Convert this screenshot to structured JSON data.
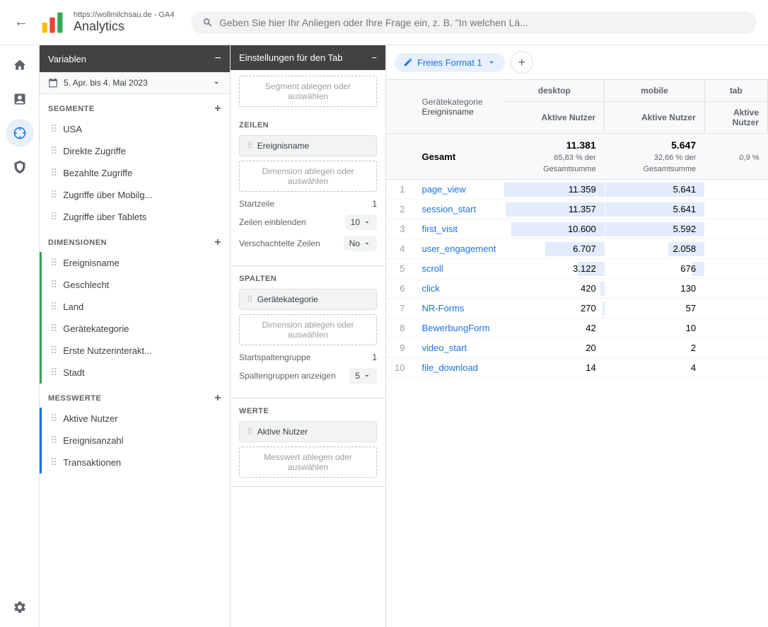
{
  "topbar": {
    "back_label": "←",
    "app_name": "Analytics",
    "subtitle": "https://wollmilchsau.de - GA4",
    "title": "https://wollmilchsau.de - GA4",
    "search_placeholder": "Geben Sie hier Ihr Anliegen oder Ihre Frage ein, z. B. \"In welchen Lä..."
  },
  "left_nav": {
    "icons": [
      {
        "name": "home-icon",
        "symbol": "⌂"
      },
      {
        "name": "chart-icon",
        "symbol": "▦"
      },
      {
        "name": "explore-icon",
        "symbol": "◎",
        "active": true
      },
      {
        "name": "ads-icon",
        "symbol": "◈"
      }
    ],
    "bottom_icons": [
      {
        "name": "settings-icon",
        "symbol": "⚙"
      }
    ]
  },
  "variables_panel": {
    "header": "Variablen",
    "date_label": "5. Apr. bis 4. Mai 2023",
    "sections": {
      "segments": {
        "title": "SEGMENTE",
        "items": [
          {
            "label": "USA"
          },
          {
            "label": "Direkte Zugriffe"
          },
          {
            "label": "Bezahlte Zugriffe"
          },
          {
            "label": "Zugriffe über Mobilg..."
          },
          {
            "label": "Zugriffe über Tablets"
          }
        ]
      },
      "dimensions": {
        "title": "DIMENSIONEN",
        "items": [
          {
            "label": "Ereignisname"
          },
          {
            "label": "Geschlecht"
          },
          {
            "label": "Land"
          },
          {
            "label": "Gerätekategorie"
          },
          {
            "label": "Erste Nutzerinterakt..."
          },
          {
            "label": "Stadt"
          }
        ]
      },
      "metrics": {
        "title": "MESSWERTE",
        "items": [
          {
            "label": "Aktive Nutzer"
          },
          {
            "label": "Ereignisanzahl"
          },
          {
            "label": "Transaktionen"
          }
        ]
      }
    }
  },
  "settings_panel": {
    "header": "Einstellungen für den Tab",
    "rows_section": {
      "title": "ZEILEN",
      "active_item": "Ereignisname",
      "drop_zone": "Dimension ablegen oder auswählen",
      "startrow_label": "Startzeile",
      "startrow_value": "1",
      "showrows_label": "Zeilen einblenden",
      "showrows_value": "10",
      "nested_label": "Verschachtelte Zeilen",
      "nested_value": "No"
    },
    "columns_section": {
      "title": "SPALTEN",
      "active_item": "Gerätekategorie",
      "drop_zone": "Dimension ablegen oder auswählen",
      "startcol_label": "Startspaltengruppe",
      "startcol_value": "1",
      "showcol_label": "Spaltengruppen anzeigen",
      "showcol_value": "5"
    },
    "values_section": {
      "title": "WERTE",
      "active_item": "Aktive Nutzer",
      "drop_zone": "Messwert ablegen oder auswählen"
    }
  },
  "data_area": {
    "tab_label": "Freies Format 1",
    "columns": {
      "device_category": {
        "groups": [
          {
            "label": "desktop",
            "metrics": [
              "Aktive Nutzer"
            ]
          },
          {
            "label": "mobile",
            "metrics": [
              "Aktive Nutzer"
            ]
          },
          {
            "label": "tab",
            "metrics": [
              "Aktive Nutzer"
            ]
          }
        ]
      }
    },
    "row_dim_header": "Ereignisname",
    "total": {
      "label": "Gesamt",
      "desktop_value": "11.381",
      "desktop_sub": "65,83 % der Gesamtsumme",
      "mobile_value": "5.647",
      "mobile_sub": "32,66 % der Gesamtsumme",
      "tab_sub": "0,9 %"
    },
    "rows": [
      {
        "num": 1,
        "name": "page_view",
        "desktop": "11.359",
        "mobile": "5.641",
        "desktop_bar": 100,
        "mobile_bar": 99
      },
      {
        "num": 2,
        "name": "session_start",
        "desktop": "11.357",
        "mobile": "5.641",
        "desktop_bar": 99,
        "mobile_bar": 99
      },
      {
        "num": 3,
        "name": "first_visit",
        "desktop": "10.600",
        "mobile": "5.592",
        "desktop_bar": 93,
        "mobile_bar": 99
      },
      {
        "num": 4,
        "name": "user_engagement",
        "desktop": "6.707",
        "mobile": "2.058",
        "desktop_bar": 59,
        "mobile_bar": 36
      },
      {
        "num": 5,
        "name": "scroll",
        "desktop": "3.122",
        "mobile": "676",
        "desktop_bar": 27,
        "mobile_bar": 12
      },
      {
        "num": 6,
        "name": "click",
        "desktop": "420",
        "mobile": "130",
        "desktop_bar": 4,
        "mobile_bar": 2
      },
      {
        "num": 7,
        "name": "NR-Forms",
        "desktop": "270",
        "mobile": "57",
        "desktop_bar": 2,
        "mobile_bar": 1
      },
      {
        "num": 8,
        "name": "BewerbungForm",
        "desktop": "42",
        "mobile": "10",
        "desktop_bar": 1,
        "mobile_bar": 0
      },
      {
        "num": 9,
        "name": "video_start",
        "desktop": "20",
        "mobile": "2",
        "desktop_bar": 0,
        "mobile_bar": 0
      },
      {
        "num": 10,
        "name": "file_download",
        "desktop": "14",
        "mobile": "4",
        "desktop_bar": 0,
        "mobile_bar": 0
      }
    ]
  }
}
